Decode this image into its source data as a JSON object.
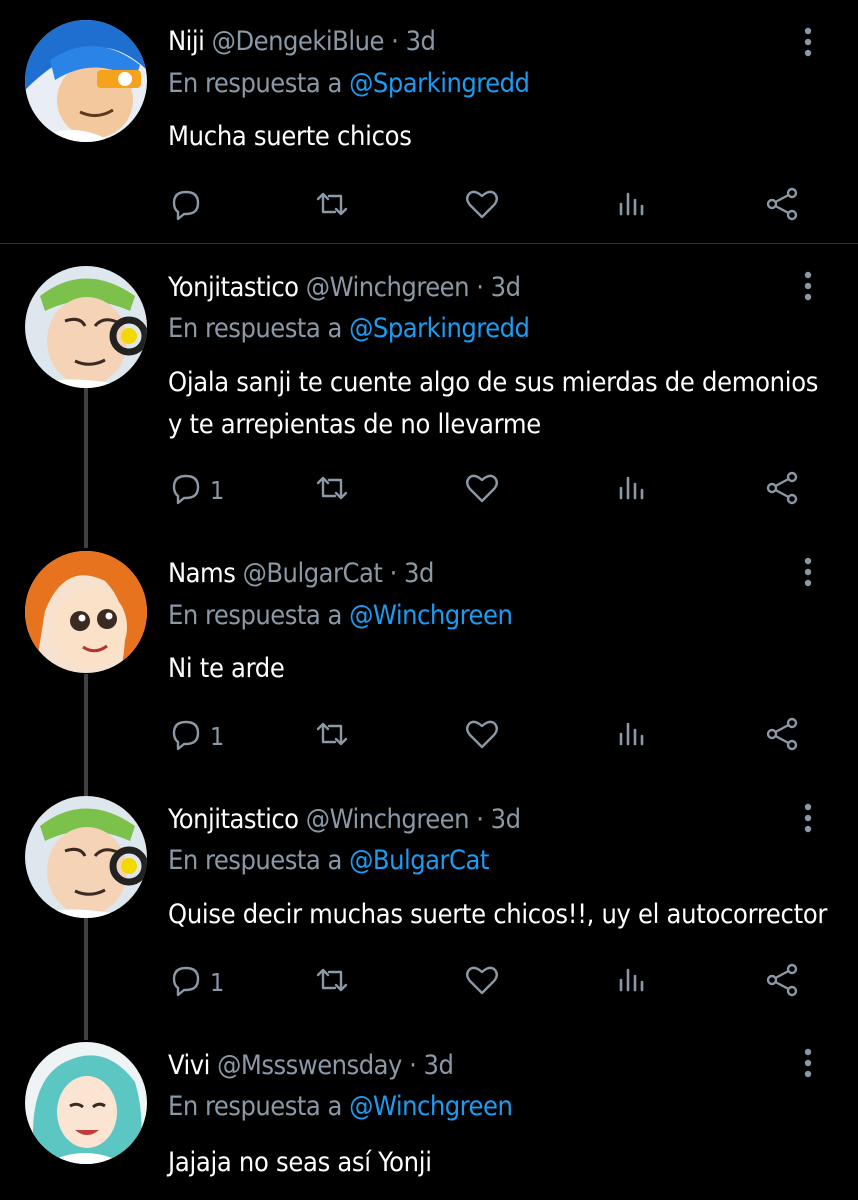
{
  "colors": {
    "background": "#000000",
    "text": "#ffffff",
    "muted": "#8b98a5",
    "link": "#1d9bf0"
  },
  "tweets": [
    {
      "name": "Niji",
      "handle": "@DengekiBlue",
      "time": "3d",
      "separator": "·",
      "reply_prefix": "En respuesta a",
      "reply_to": "@Sparkingredd",
      "text": "Mucha suerte chicos",
      "reply_count": ""
    },
    {
      "name": "Yonjitastico",
      "handle": "@Winchgreen",
      "time": "3d",
      "separator": "·",
      "reply_prefix": "En respuesta a",
      "reply_to": "@Sparkingredd",
      "text": "Ojala sanji te cuente algo de sus mierdas de demonios y te arrepientas de no llevarme",
      "reply_count": "1"
    },
    {
      "name": "Nams",
      "handle": "@BulgarCat",
      "time": "3d",
      "separator": "·",
      "reply_prefix": "En respuesta a",
      "reply_to": "@Winchgreen",
      "text": "Ni te arde",
      "reply_count": "1"
    },
    {
      "name": "Yonjitastico",
      "handle": "@Winchgreen",
      "time": "3d",
      "separator": "·",
      "reply_prefix": "En respuesta a",
      "reply_to": "@BulgarCat",
      "text": "Quise decir muchas suerte chicos!!, uy el autocorrector",
      "reply_count": "1"
    },
    {
      "name": "Vivi",
      "handle": "@Mssswensday",
      "time": "3d",
      "separator": "·",
      "reply_prefix": "En respuesta a",
      "reply_to": "@Winchgreen",
      "text": "Jajaja no seas así Yonji",
      "reply_count": ""
    }
  ],
  "icons": {
    "reply": "reply-icon",
    "retweet": "retweet-icon",
    "like": "like-icon",
    "views": "views-icon",
    "share": "share-icon",
    "more": "more-icon"
  }
}
